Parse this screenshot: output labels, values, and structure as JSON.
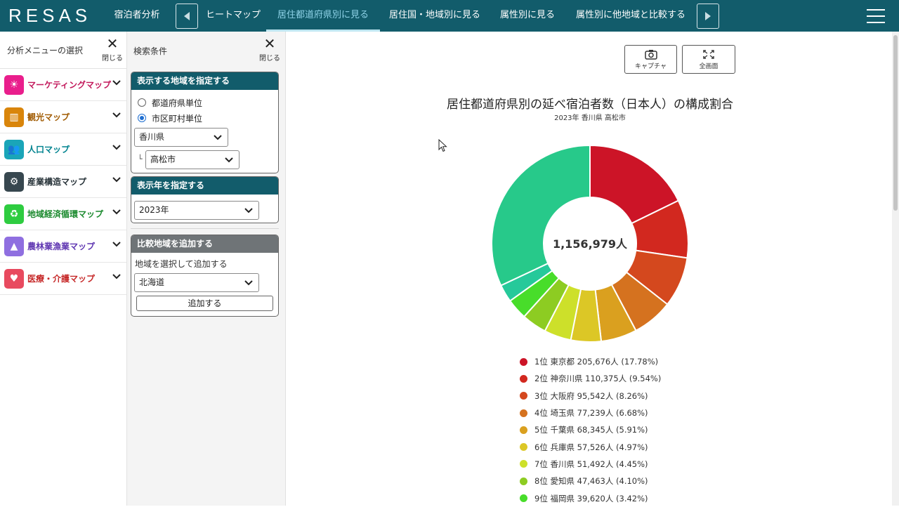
{
  "header": {
    "logo": "RESAS",
    "section": "宿泊者分析",
    "tabs": [
      {
        "label": "ヒートマップ",
        "active": false
      },
      {
        "label": "居住都道府県別に見る",
        "active": true
      },
      {
        "label": "居住国・地域別に見る",
        "active": false
      },
      {
        "label": "属性別に見る",
        "active": false
      },
      {
        "label": "属性別に他地域と比較する",
        "active": false
      }
    ]
  },
  "menu": {
    "title": "分析メニューの選択",
    "close_label": "閉じる",
    "items": [
      {
        "label": "マーケティングマップ",
        "color": "#c2185b",
        "icon_bg": "#e91e8c",
        "icon": "lightbulb-icon"
      },
      {
        "label": "観光マップ",
        "color": "#a05a00",
        "icon_bg": "#d9850b",
        "icon": "map-icon"
      },
      {
        "label": "人口マップ",
        "color": "#00838f",
        "icon_bg": "#1aa5b8",
        "icon": "people-icon"
      },
      {
        "label": "産業構造マップ",
        "color": "#263238",
        "icon_bg": "#37474f",
        "icon": "gears-icon"
      },
      {
        "label": "地域経済循環マップ",
        "color": "#1b8a2e",
        "icon_bg": "#2ecc40",
        "icon": "recycle-icon"
      },
      {
        "label": "農林業漁業マップ",
        "color": "#5e35b1",
        "icon_bg": "#8f6fe0",
        "icon": "trees-icon"
      },
      {
        "label": "医療・介護マップ",
        "color": "#c62828",
        "icon_bg": "#e84a5f",
        "icon": "heart-icon"
      }
    ]
  },
  "search": {
    "title": "検索条件",
    "close_label": "閉じる",
    "region_box": {
      "heading": "表示する地域を指定する",
      "options": [
        {
          "label": "都道府県単位",
          "selected": false
        },
        {
          "label": "市区町村単位",
          "selected": true
        }
      ],
      "prefecture": "香川県",
      "city_prefix": "└",
      "city": "高松市"
    },
    "year_box": {
      "heading": "表示年を指定する",
      "year": "2023年"
    },
    "compare_box": {
      "heading": "比較地域を追加する",
      "hint": "地域を選択して追加する",
      "region": "北海道",
      "add_button": "追加する"
    }
  },
  "toolbar": {
    "capture_label": "キャプチャ",
    "fullscreen_label": "全画面"
  },
  "chart_data": {
    "type": "pie",
    "title": "居住都道府県別の延べ宿泊者数（日本人）の構成割合",
    "subtitle": "2023年 香川県 高松市",
    "center_label": "1,156,979人",
    "slices": [
      {
        "label": "1位 東京都 205,676人 (17.78%)",
        "name": "東京都",
        "value": 205676,
        "percent": 17.78,
        "color": "#cc1427"
      },
      {
        "label": "2位 神奈川県 110,375人 (9.54%)",
        "name": "神奈川県",
        "value": 110375,
        "percent": 9.54,
        "color": "#d2281f"
      },
      {
        "label": "3位 大阪府 95,542人 (8.26%)",
        "name": "大阪府",
        "value": 95542,
        "percent": 8.26,
        "color": "#d4481e"
      },
      {
        "label": "4位 埼玉県 77,239人 (6.68%)",
        "name": "埼玉県",
        "value": 77239,
        "percent": 6.68,
        "color": "#d5721f"
      },
      {
        "label": "5位 千葉県 68,345人 (5.91%)",
        "name": "千葉県",
        "value": 68345,
        "percent": 5.91,
        "color": "#daa01f"
      },
      {
        "label": "6位 兵庫県 57,526人 (4.97%)",
        "name": "兵庫県",
        "value": 57526,
        "percent": 4.97,
        "color": "#dcc726"
      },
      {
        "label": "7位 香川県 51,492人 (4.45%)",
        "name": "香川県",
        "value": 51492,
        "percent": 4.45,
        "color": "#cde02a"
      },
      {
        "label": "8位 愛知県 47,463人 (4.10%)",
        "name": "愛知県",
        "value": 47463,
        "percent": 4.1,
        "color": "#8dcc22"
      },
      {
        "label": "9位 福岡県 39,620人 (3.42%)",
        "name": "福岡県",
        "value": 39620,
        "percent": 3.42,
        "color": "#48dd2a"
      }
    ],
    "remaining_slices": [
      {
        "percent": 2.9,
        "color": "#26c99a"
      },
      {
        "percent": 31.99,
        "color": "#27c98a"
      }
    ]
  }
}
